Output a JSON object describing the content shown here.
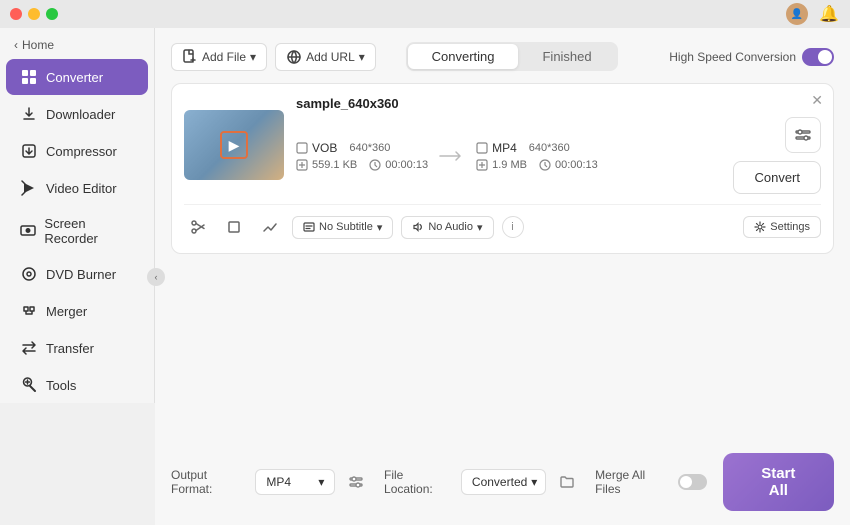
{
  "titlebar": {
    "buttons": [
      "close",
      "minimize",
      "maximize"
    ],
    "user_icon": "👤",
    "bell_icon": "🔔"
  },
  "sidebar": {
    "home_label": "Home",
    "items": [
      {
        "id": "converter",
        "label": "Converter",
        "icon": "⊞",
        "active": true
      },
      {
        "id": "downloader",
        "label": "Downloader",
        "icon": "⬇"
      },
      {
        "id": "compressor",
        "label": "Compressor",
        "icon": "⊡"
      },
      {
        "id": "video-editor",
        "label": "Video Editor",
        "icon": "✂"
      },
      {
        "id": "screen-recorder",
        "label": "Screen Recorder",
        "icon": "◉"
      },
      {
        "id": "dvd-burner",
        "label": "DVD Burner",
        "icon": "💿"
      },
      {
        "id": "merger",
        "label": "Merger",
        "icon": "⊞"
      },
      {
        "id": "transfer",
        "label": "Transfer",
        "icon": "⇄"
      },
      {
        "id": "tools",
        "label": "Tools",
        "icon": "⚙"
      }
    ]
  },
  "toolbar": {
    "add_file_label": "Add File",
    "add_url_label": "Add URL"
  },
  "tabs": {
    "converting_label": "Converting",
    "finished_label": "Finished",
    "active": "converting"
  },
  "speed_toggle": {
    "label": "High Speed Conversion",
    "enabled": true
  },
  "file_card": {
    "title": "sample_640x360",
    "input_format": "VOB",
    "input_resolution": "640*360",
    "input_size": "559.1 KB",
    "input_duration": "00:00:13",
    "output_format": "MP4",
    "output_resolution": "640*360",
    "output_size": "1.9 MB",
    "output_duration": "00:00:13",
    "subtitle": "No Subtitle",
    "audio": "No Audio",
    "convert_btn": "Convert",
    "settings_btn": "Settings"
  },
  "bottom_bar": {
    "output_format_label": "Output Format:",
    "output_format_value": "MP4",
    "file_location_label": "File Location:",
    "file_location_value": "Converted",
    "merge_label": "Merge All Files",
    "merge_enabled": false,
    "start_all_label": "Start All"
  }
}
